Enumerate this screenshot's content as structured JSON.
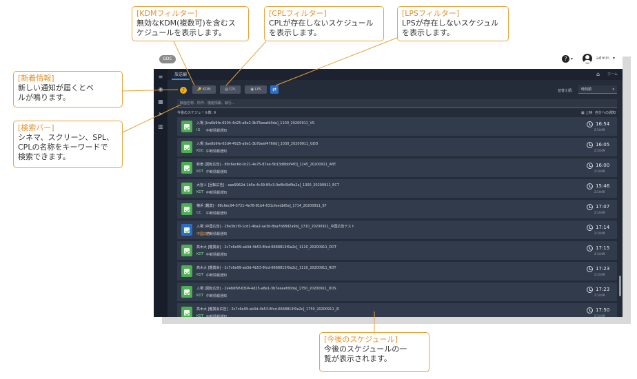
{
  "app": {
    "logo_text": "GDC",
    "help_icon": "question-circle-icon",
    "user_name": "admin"
  },
  "tab": {
    "title": "放送編",
    "home_text": "ホーム"
  },
  "toolbar": {
    "filters": [
      {
        "label": "🔑 KDM"
      },
      {
        "label": "▤ CPL"
      },
      {
        "label": "▣ LPS"
      }
    ],
    "sort_label": "並替え順:",
    "sort_value": "時刻順"
  },
  "search": {
    "placeholder": "映画名称、所作、機能情報、執行..."
  },
  "list_header": {
    "count_label": "今後のスケジュール数: 9",
    "option1": "▦ 上映",
    "option2": "自分への通知"
  },
  "schedules": [
    {
      "title": "入場 [Iva6b9fe-6304-4d25-a8e2-3b75eeafd0da]_1100_20200911_VS",
      "tag": "IG",
      "sub": "中断情報通知",
      "time": "16:54",
      "dur": "2:14:09",
      "icon": "green"
    },
    {
      "title": "入場 [Iae8b9fe-63d4-4925-a8e1-3b7beef4760d]_1030_20200911_GDD",
      "tag": "KDC",
      "sub": "中断情報通知",
      "time": "16:05",
      "dur": "2:14:09",
      "icon": "green"
    },
    {
      "title": "新宿 [回転広告] - 89c6ec6d-0c21-4e75-87ee-5b13d6bbf4f0]_1245_20200911_ABT",
      "tag": "KDT",
      "sub": "中断情報通知",
      "time": "16:00",
      "dur": "2:14:09",
      "icon": "green"
    },
    {
      "title": "大宮人 [回転広告] - aae9962d-1b5e-4c39-85c3-0ef8c5bf9e2a]_1300_20200911_ECT",
      "tag": "KDT",
      "sub": "中断情報通知",
      "time": "15:46",
      "dur": "2:14:09",
      "icon": "green"
    },
    {
      "title": "横浜 [鑑賞] - 88c6ec94-5721-4e78-81b4-631cfeedbf0a]_1714_20200911_SF",
      "tag": "CC",
      "sub": "中断情報通知",
      "time": "17:07",
      "dur": "2:14:09",
      "icon": "green"
    },
    {
      "title": "入場 [中国広告] - 28e3b1f0-1cd1-4ba2-ae3d-8ba7b68d2a9b]_1710_20200911_中国広告テスト",
      "tag": "中国広告",
      "sub": "中断情報通知",
      "time": "17:14",
      "dur": "2:14:09",
      "icon": "blue"
    },
    {
      "title": "高木大 [鑑賞会] - 2c7c6e99-ab3d-4b53-8fcd-6668813f0a2c]_1110_20200911_DDT",
      "tag": "KDT",
      "sub": "中断情報通知",
      "time": "17:15",
      "dur": "2:14:09",
      "icon": "green"
    },
    {
      "title": "高木大 [鑑賞会] - 2c7c6e99-ab3d-4b53-8fcd-6668813f0a2c]_1110_20200911_RDT",
      "tag": "KDT",
      "sub": "中断情報通知",
      "time": "17:23",
      "dur": "2:14:09",
      "icon": "green"
    },
    {
      "title": "入場 [回転広告] - 2e4b6f9f-6304-4d25-a8e1-3b7eeaefd0da]_1750_20200911_DDS",
      "tag": "KDT",
      "sub": "中断情報通知",
      "time": "17:23",
      "dur": "2:14:09",
      "icon": "green"
    },
    {
      "title": "高木大 [鑑賞会広告] - 2c7c6e99-ab3d-4b53-8fcd-6668813f0a2c]_1750_20200911_JS",
      "tag": "KDT",
      "sub": "中断情報通知",
      "time": "17:50",
      "dur": "2:14:09",
      "icon": "green"
    }
  ],
  "callouts": {
    "kdm": {
      "title": "[KDMフィルター]",
      "body": "無効なKDM(複数可)を含むス\nケジュールを表示します。"
    },
    "cpl": {
      "title": "[CPLフィルター]",
      "body": "CPLが存在しないスケジュール\nを表示します。"
    },
    "lps": {
      "title": "[LPSフィルター]",
      "body": "LPSが存在しないスケジュル\nを表示します。"
    },
    "notice": {
      "title": "[新着情報]",
      "body": "新しい通知が届くとベ\nルが鳴ります。"
    },
    "search": {
      "title": "[検索バー]",
      "body": "シネマ、スクリーン、SPL、\nCPLの名称をキーワードで\n検索できます。"
    },
    "upcoming": {
      "title": "[今後のスケジュール]",
      "body": "今後のスケジュールの一\n覧が表示されます。"
    }
  },
  "colors": {
    "accent_orange": "#e8902a",
    "bell_yellow": "#f2b01e",
    "sched_green": "#4caf50",
    "sched_blue": "#2a6fc6",
    "swap_blue": "#2c6fc9"
  }
}
